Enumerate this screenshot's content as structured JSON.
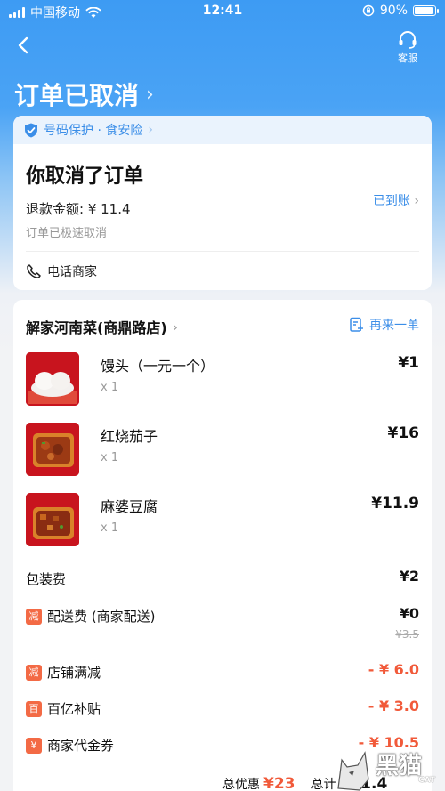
{
  "status_bar": {
    "carrier": "中国移动",
    "time": "12:41",
    "battery": "90%",
    "battery_level": 0.9
  },
  "nav": {
    "service_label": "客服"
  },
  "page": {
    "title": "订单已取消"
  },
  "status_card": {
    "protection": "号码保护 · 食安险",
    "title": "你取消了订单",
    "refund": "退款金额: ¥ 11.4",
    "refund_status": "已到账",
    "note": "订单已极速取消",
    "call_label": "电话商家"
  },
  "order": {
    "store_name": "解家河南菜(商鼎路店)",
    "reorder_label": "再来一单",
    "items": [
      {
        "name": "馒头（一元一个）",
        "qty": "x 1",
        "price": "¥1"
      },
      {
        "name": "红烧茄子",
        "qty": "x 1",
        "price": "¥16"
      },
      {
        "name": "麻婆豆腐",
        "qty": "x 1",
        "price": "¥11.9"
      }
    ],
    "fees": [
      {
        "label": "包装费",
        "value": "¥2"
      },
      {
        "badge": "减",
        "label": "配送费 (商家配送)",
        "value": "¥0",
        "original": "¥3.5"
      },
      {
        "badge": "减",
        "label": "店铺满减",
        "value": "- ¥ 6.0"
      },
      {
        "badge": "百",
        "label": "百亿补贴",
        "value": "- ¥ 3.0"
      },
      {
        "badge": "¥",
        "label": "商家代金券",
        "value": "- ¥ 10.5"
      }
    ],
    "summary": {
      "discount_label": "总优惠",
      "discount_value": "¥23",
      "total_label": "总计",
      "total_value": "¥11.4"
    }
  },
  "watermark": {
    "text": "黑猫",
    "sub": "CAT"
  },
  "colors": {
    "accent": "#3b8ee8",
    "discount": "#f15a3a",
    "header": "#3d9bf3"
  }
}
